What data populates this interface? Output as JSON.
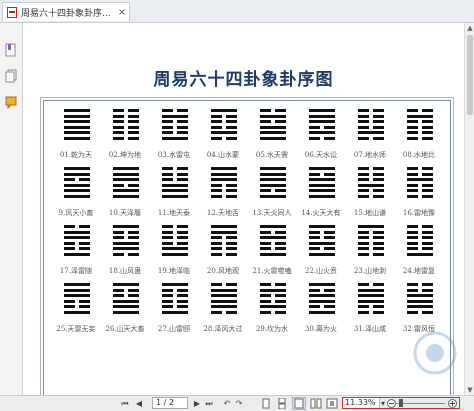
{
  "tab": {
    "title": "周易六十四卦象卦序...",
    "close": "×"
  },
  "document": {
    "title": "周易六十四卦象卦序图",
    "hexagrams": [
      {
        "label": "01.乾为天",
        "lines": [
          1,
          1,
          1,
          1,
          1,
          1
        ]
      },
      {
        "label": "02.坤为地",
        "lines": [
          0,
          0,
          0,
          0,
          0,
          0
        ]
      },
      {
        "label": "03.水雷屯",
        "lines": [
          0,
          1,
          0,
          0,
          0,
          1
        ]
      },
      {
        "label": "04.山水蒙",
        "lines": [
          1,
          0,
          0,
          0,
          1,
          0
        ]
      },
      {
        "label": "05.水天需",
        "lines": [
          0,
          1,
          0,
          1,
          1,
          1
        ]
      },
      {
        "label": "06.天水讼",
        "lines": [
          1,
          1,
          1,
          0,
          1,
          0
        ]
      },
      {
        "label": "07.地水师",
        "lines": [
          0,
          0,
          0,
          0,
          1,
          0
        ]
      },
      {
        "label": "08.水地比",
        "lines": [
          0,
          1,
          0,
          0,
          0,
          0
        ]
      },
      {
        "label": "9.风天小畜",
        "lines": [
          1,
          1,
          0,
          1,
          1,
          1
        ]
      },
      {
        "label": "10.天泽履",
        "lines": [
          1,
          1,
          1,
          0,
          1,
          1
        ]
      },
      {
        "label": "11.地天泰",
        "lines": [
          0,
          0,
          0,
          1,
          1,
          1
        ]
      },
      {
        "label": "12.天地否",
        "lines": [
          1,
          1,
          1,
          0,
          0,
          0
        ]
      },
      {
        "label": "13.天火同人",
        "lines": [
          1,
          1,
          1,
          1,
          0,
          1
        ]
      },
      {
        "label": "14.火天大有",
        "lines": [
          1,
          0,
          1,
          1,
          1,
          1
        ]
      },
      {
        "label": "15.地山谦",
        "lines": [
          0,
          0,
          0,
          1,
          0,
          0
        ]
      },
      {
        "label": "16.雷地豫",
        "lines": [
          0,
          0,
          1,
          0,
          0,
          0
        ]
      },
      {
        "label": "17.泽雷随",
        "lines": [
          0,
          1,
          1,
          0,
          0,
          1
        ]
      },
      {
        "label": "18.山风蛊",
        "lines": [
          1,
          0,
          0,
          1,
          1,
          0
        ]
      },
      {
        "label": "19.地泽临",
        "lines": [
          0,
          0,
          0,
          0,
          1,
          1
        ]
      },
      {
        "label": "20.风地观",
        "lines": [
          1,
          1,
          0,
          0,
          0,
          0
        ]
      },
      {
        "label": "21.火雷噬嗑",
        "lines": [
          1,
          0,
          1,
          0,
          0,
          1
        ]
      },
      {
        "label": "22.山火贲",
        "lines": [
          1,
          0,
          0,
          1,
          0,
          1
        ]
      },
      {
        "label": "23.山地剥",
        "lines": [
          1,
          0,
          0,
          0,
          0,
          0
        ]
      },
      {
        "label": "24.地雷复",
        "lines": [
          0,
          0,
          0,
          0,
          0,
          1
        ]
      },
      {
        "label": "25.天雷无妄",
        "lines": [
          1,
          1,
          1,
          0,
          0,
          1
        ]
      },
      {
        "label": "26.山天大畜",
        "lines": [
          1,
          0,
          0,
          1,
          1,
          1
        ]
      },
      {
        "label": "27.山雷颐",
        "lines": [
          1,
          0,
          0,
          0,
          0,
          1
        ]
      },
      {
        "label": "28.泽风大过",
        "lines": [
          0,
          1,
          1,
          1,
          1,
          0
        ]
      },
      {
        "label": "29.坎为水",
        "lines": [
          0,
          1,
          0,
          0,
          1,
          0
        ]
      },
      {
        "label": "30.离为火",
        "lines": [
          1,
          0,
          1,
          1,
          0,
          1
        ]
      },
      {
        "label": "31.泽山咸",
        "lines": [
          0,
          1,
          1,
          1,
          0,
          0
        ]
      },
      {
        "label": "32.雷风恒",
        "lines": [
          0,
          0,
          1,
          1,
          1,
          0
        ]
      }
    ]
  },
  "statusbar": {
    "page_value": "1 / 2",
    "zoom_value": "11.33%",
    "zoom_level_percent": 11.33
  },
  "colors": {
    "title": "#1f3b66",
    "zoom_border": "#d23030"
  }
}
